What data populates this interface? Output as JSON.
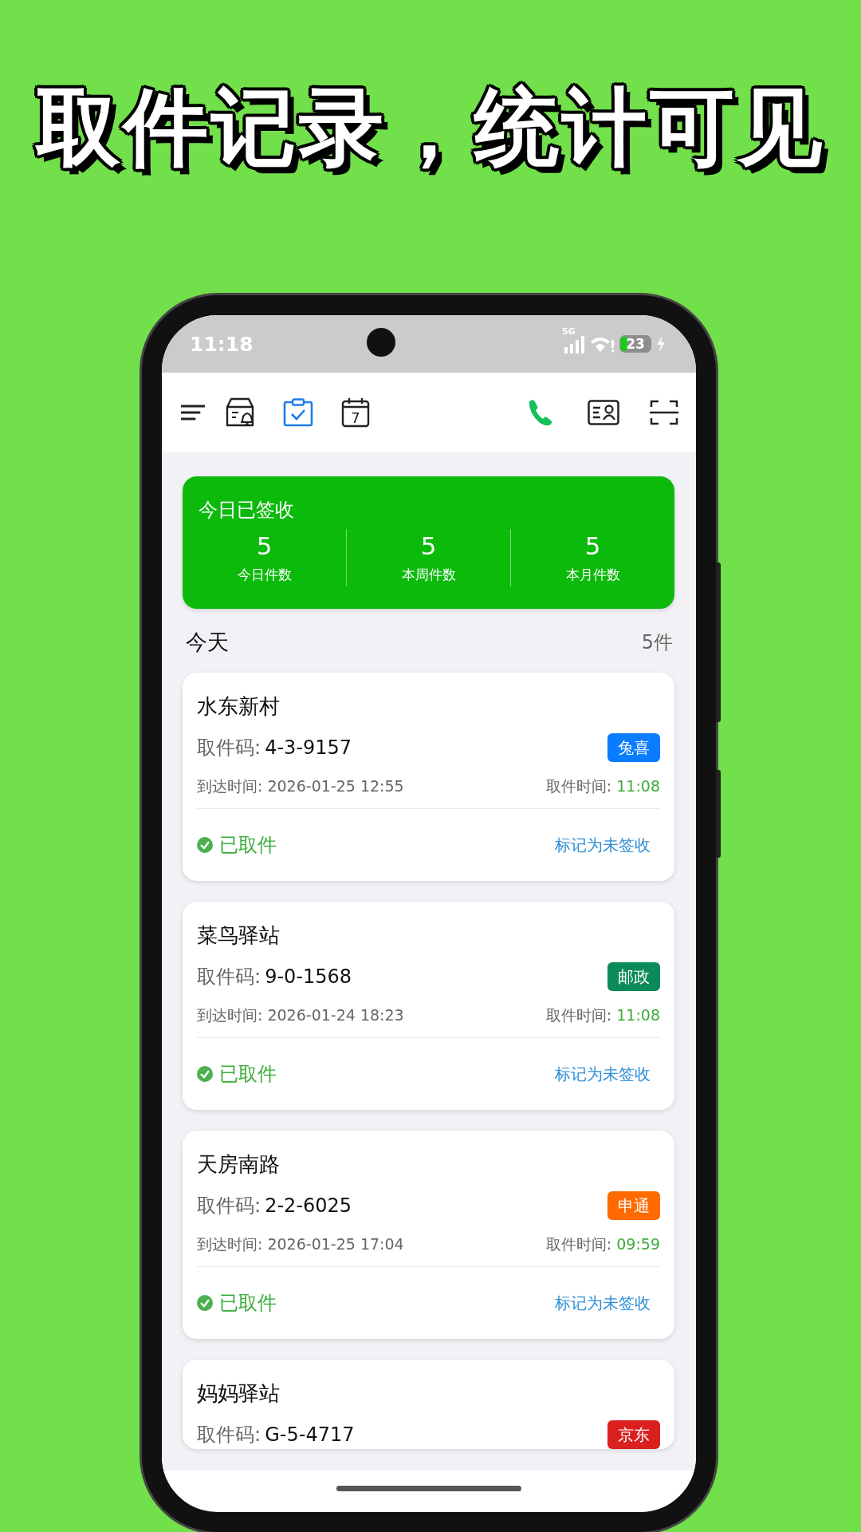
{
  "headline": "取件记录，统计可见",
  "status_bar": {
    "time": "11:18",
    "network": "5G",
    "battery": "23"
  },
  "toolbar": {
    "tabs": [
      {
        "kind": "station",
        "selected": false
      },
      {
        "kind": "signed",
        "selected": true
      },
      {
        "kind": "calendar",
        "selected": false
      }
    ],
    "calendar_day": "7"
  },
  "summary": {
    "title": "今日已签收",
    "stats": [
      {
        "value": "5",
        "label": "今日件数"
      },
      {
        "value": "5",
        "label": "本周件数"
      },
      {
        "value": "5",
        "label": "本月件数"
      }
    ]
  },
  "section": {
    "title": "今天",
    "count": "5件"
  },
  "parcels": [
    {
      "station": "水东新村",
      "code_label": "取件码:",
      "code": "4-3-9157",
      "carrier": "兔喜",
      "color": "#0a7cff",
      "arrival": "到达时间: 2026-01-25 12:55",
      "pickup_label": "取件时间:",
      "pickup_time": "11:08",
      "picked": true,
      "status": "已取件",
      "action": "标记为未签收"
    },
    {
      "station": "菜鸟驿站",
      "code_label": "取件码:",
      "code": "9-0-1568",
      "carrier": "邮政",
      "color": "#0b8a5a",
      "arrival": "到达时间: 2026-01-24 18:23",
      "pickup_label": "取件时间:",
      "pickup_time": "11:08",
      "picked": true,
      "status": "已取件",
      "action": "标记为未签收"
    },
    {
      "station": "天房南路",
      "code_label": "取件码:",
      "code": "2-2-6025",
      "carrier": "申通",
      "color": "#ff6a00",
      "arrival": "到达时间: 2026-01-25 17:04",
      "pickup_label": "取件时间:",
      "pickup_time": "09:59",
      "picked": true,
      "status": "已取件",
      "action": "标记为未签收"
    },
    {
      "station": "妈妈驿站",
      "code_label": "取件码:",
      "code": "G-5-4717",
      "carrier": "京东",
      "color": "#d9201e"
    }
  ]
}
